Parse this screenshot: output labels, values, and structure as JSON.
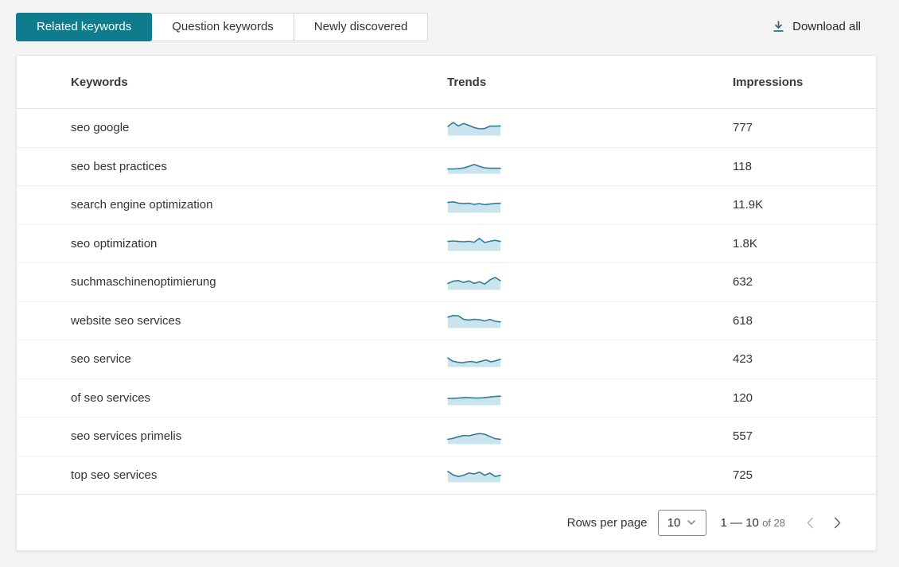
{
  "colors": {
    "accent": "#0E7C8C",
    "spark_line": "#2D7F9D",
    "spark_fill": "#CBE3EC",
    "download_arrow": "#3F5D6B",
    "download_underline": "#12818F",
    "chevron_disabled": "#B9B9B9",
    "chevron_enabled": "#686868"
  },
  "tabs": [
    {
      "label": "Related keywords",
      "active": true
    },
    {
      "label": "Question keywords",
      "active": false
    },
    {
      "label": "Newly discovered",
      "active": false
    }
  ],
  "download_all_label": "Download all",
  "table": {
    "columns": [
      "Keywords",
      "Trends",
      "Impressions"
    ],
    "rows": [
      {
        "keyword": "seo google",
        "impressions": "777",
        "trend": [
          55,
          80,
          58,
          74,
          62,
          48,
          40,
          42,
          57,
          57,
          58
        ]
      },
      {
        "keyword": "seo best practices",
        "impressions": "118",
        "trend": [
          28,
          28,
          30,
          34,
          44,
          56,
          44,
          35,
          32,
          32,
          32
        ]
      },
      {
        "keyword": "search engine optimization",
        "impressions": "11.9K",
        "trend": [
          62,
          66,
          58,
          55,
          57,
          50,
          55,
          48,
          52,
          56,
          57
        ]
      },
      {
        "keyword": "seo optimization",
        "impressions": "1.8K",
        "trend": [
          57,
          60,
          57,
          55,
          58,
          52,
          76,
          50,
          58,
          64,
          57
        ]
      },
      {
        "keyword": "suchmaschinenoptimierung",
        "impressions": "632",
        "trend": [
          38,
          52,
          56,
          44,
          54,
          38,
          48,
          34,
          60,
          76,
          55
        ]
      },
      {
        "keyword": "website seo services",
        "impressions": "618",
        "trend": [
          66,
          76,
          74,
          52,
          48,
          52,
          50,
          42,
          52,
          40,
          36
        ]
      },
      {
        "keyword": "seo service",
        "impressions": "423",
        "trend": [
          54,
          34,
          28,
          24,
          30,
          32,
          26,
          34,
          42,
          30,
          36,
          46
        ]
      },
      {
        "keyword": "of seo services",
        "impressions": "120",
        "trend": [
          40,
          41,
          43,
          46,
          44,
          42,
          44,
          48,
          52,
          54
        ]
      },
      {
        "keyword": "seo services primelis",
        "impressions": "557",
        "trend": [
          28,
          34,
          44,
          52,
          50,
          58,
          64,
          60,
          46,
          32,
          28
        ]
      },
      {
        "keyword": "top seo services",
        "impressions": "725",
        "trend": [
          66,
          44,
          34,
          42,
          56,
          50,
          62,
          42,
          56,
          34,
          42
        ]
      }
    ]
  },
  "pagination": {
    "rows_per_page_label": "Rows per page",
    "rows_per_page_value": "10",
    "range_label": "1 — 10",
    "of_label": "of 28"
  }
}
